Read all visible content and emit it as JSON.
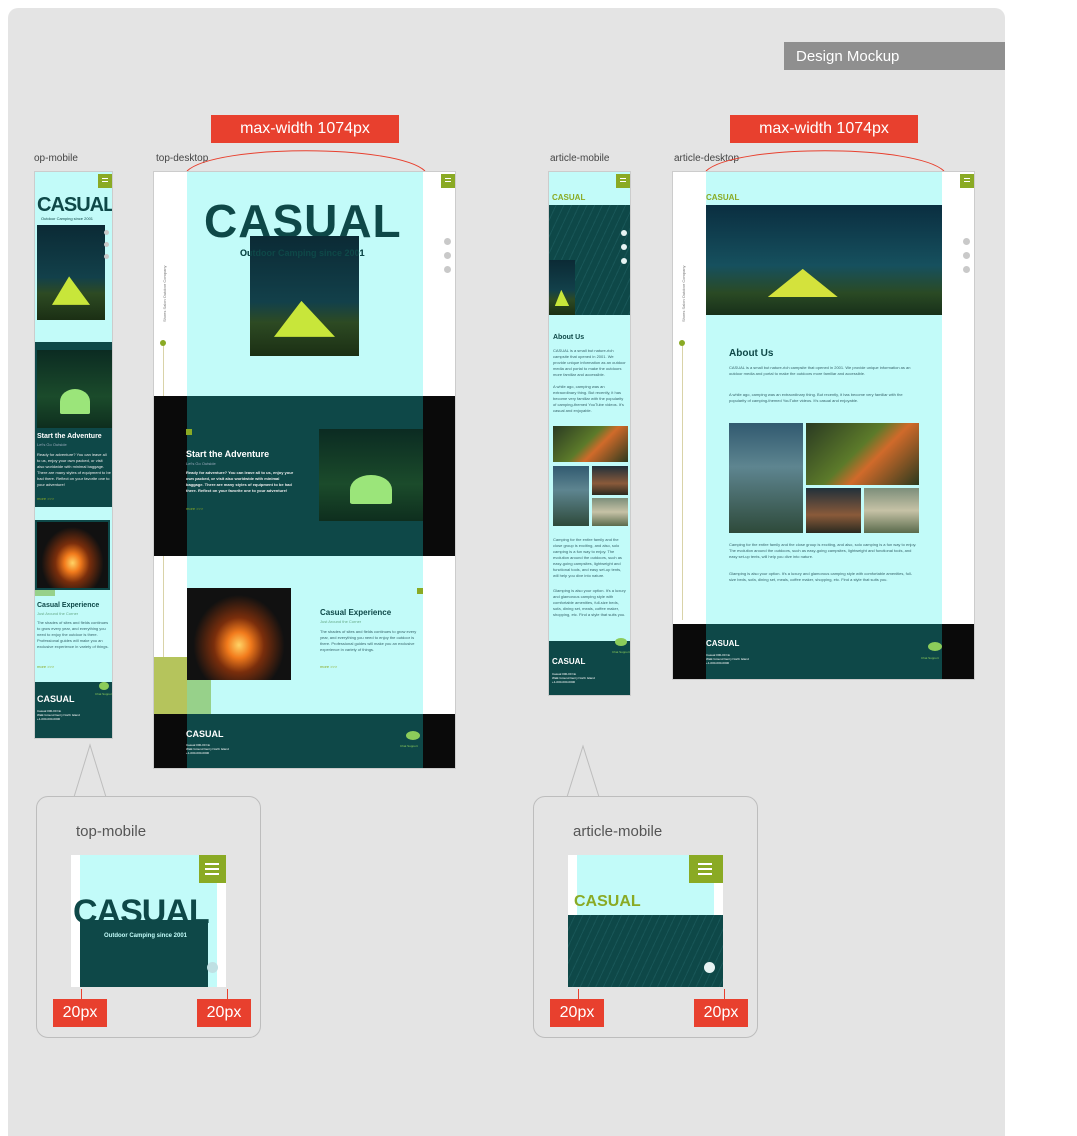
{
  "tag": "Design Mockup",
  "labels": {
    "top_mobile": "op-mobile",
    "top_desktop": "top-desktop",
    "article_mobile": "article-mobile",
    "article_desktop": "article-desktop",
    "zoom_top_mobile": "top-mobile",
    "zoom_article_mobile": "article-mobile"
  },
  "max_width_label": "max-width 1074px",
  "padding_label": "20px",
  "site": {
    "brand": "CASUAL",
    "tagline": "Outdoor Camping since 2001",
    "vertical_text": "Shoes Salon Outdoor Company",
    "section1_title": "Start the Adventure",
    "section1_sub": "Let's Go Outside",
    "section1_body": "Ready for adventure? You can leave all to us, enjoy your own packed, or visit also worldwide with minimal baggage. There are many styles of equipment to be had there. Reflect on your favorite one to your adventure!",
    "section2_title": "Casual Experience",
    "section2_sub": "Just Around the Corner",
    "section2_body": "The shades of sites and fields continues to grow every year, and everything you need to enjoy the outdoor is there. Professional guides will make you an exclusive experience in variety of things.",
    "more_link": "more >>>",
    "about_title": "About Us",
    "about_p1": "CASUAL is a small but nature-rich campsite that opened in 2001. We provide unique information as an outdoor media and portal to make the outdoors more familiar and accessible.",
    "about_p2": "A while ago, camping was an extraordinary thing. But recently, it has become very familiar with the popularity of camping-themed YouTube videos. It's casual and enjoyable.",
    "about_p3": "Camping for the entire family and the close group is exciting, and also, solo camping is a fun way to enjoy. The evolution around the outdoors, such as easy-going campsites, lightweight and functional tools, and easy set-up tents, will help you dive into nature.",
    "about_p4": "Glamping is also your option. It's a luxury and glamorous camping style with comfortable amenities, full-size beds, sofa, dining set, meals, coffee maker, shopping, etc. Find a style that suits you.",
    "footer_brand": "CASUAL",
    "footer_addr1": "Casual 000-00 No",
    "footer_addr2": "Walk Ground Gerry North Island",
    "footer_tel": "+1-000-000-0000",
    "chat": "Chat Support"
  },
  "colors": {
    "cyan_overlay": "#c2fbf9",
    "dark_teal": "#0e4848",
    "lime": "#8aaa24",
    "annotation_red": "#e8402e"
  }
}
